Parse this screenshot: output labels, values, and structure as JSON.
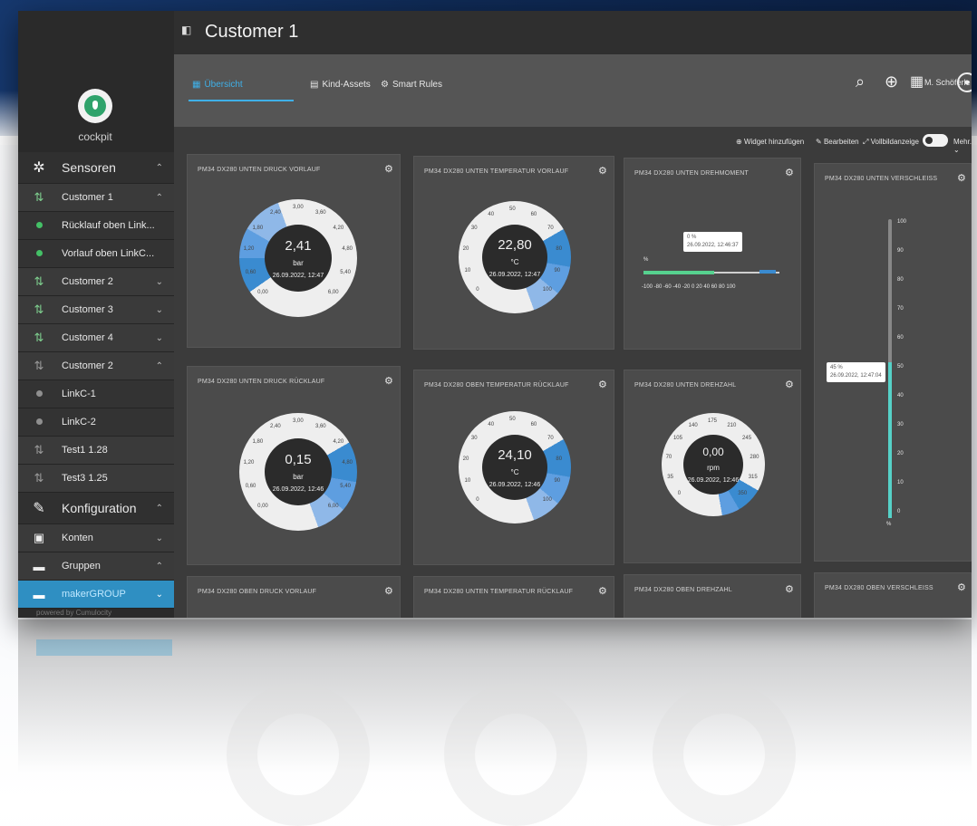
{
  "sidebar": {
    "logo_text": "cockpit",
    "items": [
      {
        "label": "Sensoren",
        "icon": "sensor-icon"
      },
      {
        "label": "Customer 1"
      },
      {
        "label": "Rücklauf oben Link..."
      },
      {
        "label": "Vorlauf oben LinkC..."
      },
      {
        "label": "Customer 2"
      },
      {
        "label": "Customer 3"
      },
      {
        "label": "Customer 4"
      },
      {
        "label": "Customer 2"
      },
      {
        "label": "LinkC-1"
      },
      {
        "label": "LinkC-2"
      },
      {
        "label": "Test1 1.28"
      },
      {
        "label": "Test3 1.25"
      },
      {
        "label": "Konfiguration"
      },
      {
        "label": "Konten"
      },
      {
        "label": "Gruppen"
      },
      {
        "label": "makerGROUP"
      }
    ],
    "powered": "powered by Cumulocity"
  },
  "header": {
    "title": "Customer 1",
    "tabs": [
      {
        "label": "Übersicht",
        "active": true
      },
      {
        "label": "Kind-Assets"
      },
      {
        "label": "Smart Rules"
      }
    ],
    "user": "M. Schöferle"
  },
  "toolbar": {
    "add_widget": "Widget hinzufügen",
    "edit": "Bearbeiten",
    "fullscreen": "Vollbildanzeige",
    "more": "Mehr..."
  },
  "widgets": [
    {
      "title": "PM34 DX280 UNTEN DRUCK VORLAUF",
      "value": "2,41",
      "unit": "bar",
      "date": "26.09.2022, 12:47",
      "ticks": [
        "0,00",
        "0,60",
        "1,20",
        "1,80",
        "2,40",
        "3,00",
        "3,60",
        "4,20",
        "4,80",
        "5,40",
        "6,00"
      ]
    },
    {
      "title": "PM34 DX280 UNTEN TEMPERATUR VORLAUF",
      "value": "22,80",
      "unit": "°C",
      "date": "26.09.2022, 12:47",
      "ticks": [
        "0",
        "10",
        "20",
        "30",
        "40",
        "50",
        "60",
        "70",
        "80",
        "90",
        "100"
      ]
    },
    {
      "title": "PM34 DX280 UNTEN DREHMOMENT",
      "tooltip_value": "0 %",
      "tooltip_date": "26.09.2022, 12:46:37",
      "unit": "%",
      "ticks": "-100 -80 -60 -40 -20 0 20 40 60 80 100"
    },
    {
      "title": "PM34 DX280 UNTEN VERSCHLEISS",
      "tooltip_value": "45 %",
      "tooltip_date": "26.09.2022, 12:47:04",
      "unit": "%",
      "ticks": [
        "100",
        "90",
        "80",
        "70",
        "60",
        "50",
        "40",
        "30",
        "20",
        "10",
        "0"
      ]
    },
    {
      "title": "PM34 DX280 UNTEN DRUCK RÜCKLAUF",
      "value": "0,15",
      "unit": "bar",
      "date": "26.09.2022, 12:46",
      "ticks": [
        "0,00",
        "0,60",
        "1,20",
        "1,80",
        "2,40",
        "3,00",
        "3,60",
        "4,20",
        "4,80",
        "5,40",
        "6,00"
      ]
    },
    {
      "title": "PM34 DX280 OBEN TEMPERATUR RÜCKLAUF",
      "value": "24,10",
      "unit": "°C",
      "date": "26.09.2022, 12:46",
      "ticks": [
        "0",
        "10",
        "20",
        "30",
        "40",
        "50",
        "60",
        "70",
        "80",
        "90",
        "100"
      ]
    },
    {
      "title": "PM34 DX280 UNTEN DREHZAHL",
      "value": "0,00",
      "unit": "rpm",
      "date": "26.09.2022, 12:46",
      "ticks": [
        "0",
        "35",
        "70",
        "105",
        "140",
        "175",
        "210",
        "245",
        "280",
        "315",
        "350"
      ]
    },
    {
      "title": "PM34 DX280 OBEN DRUCK VORLAUF"
    },
    {
      "title": "PM34 DX280 UNTEN TEMPERATUR RÜCKLAUF"
    },
    {
      "title": "PM34 DX280 OBEN DREHZAHL"
    },
    {
      "title": "PM34 DX280 OBEN VERSCHLEISS"
    }
  ],
  "colors": {
    "accent": "#3fb0e8",
    "active_nav": "#2f8fc2",
    "status_green": "#44c066"
  }
}
